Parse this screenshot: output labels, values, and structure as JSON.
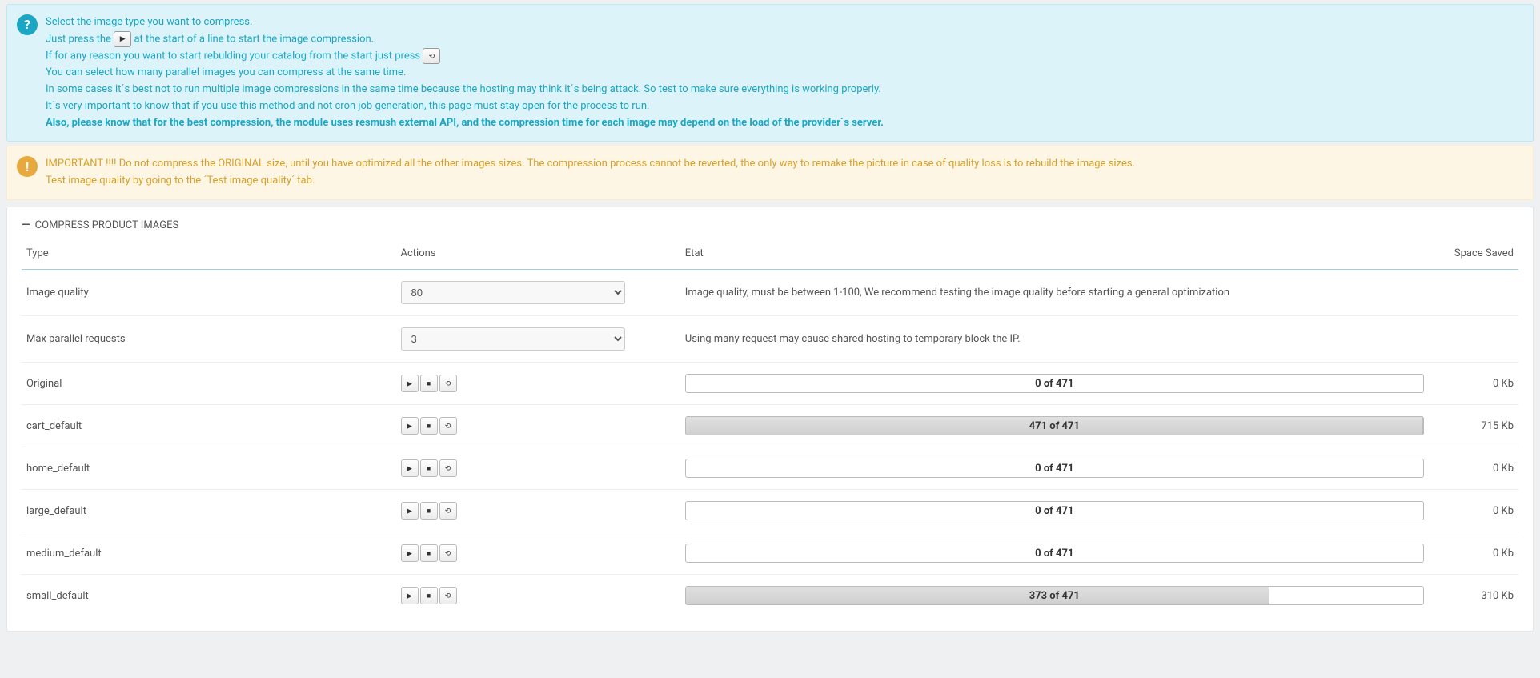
{
  "info_alert": {
    "line1": "Select the image type you want to compress.",
    "line2_a": "Just press the",
    "line2_b": "at the start of a line to start the image compression.",
    "line3_a": "If for any reason you want to start rebulding your catalog from the start just press",
    "line4": "You can select how many parallel images you can compress at the same time.",
    "line5": "In some cases it´s best not to run multiple image compressions in the same time because the hosting may think it´s being attack. So test to make sure everything is working properly.",
    "line6": "It´s very important to know that if you use this method and not cron job generation, this page must stay open for the process to run.",
    "line7": "Also, please know that for the best compression, the module uses resmush external API, and the compression time for each image may depend on the load of the provider´s server."
  },
  "warning_alert": {
    "l1": "IMPORTANT !!!! Do not compress the ORIGINAL size, until you have optimized all the other images sizes. The compression process cannot be reverted, the only way to remake the picture in case of quality loss is to rebuild the image sizes.",
    "l2": "Test image quality by going to the ´Test image quality´ tab."
  },
  "panel": {
    "title": "COMPRESS PRODUCT IMAGES"
  },
  "table": {
    "headers": {
      "type": "Type",
      "actions": "Actions",
      "etat": "Etat",
      "saved": "Space Saved"
    }
  },
  "settings": {
    "image_quality": {
      "label": "Image quality",
      "value": "80",
      "hint": "Image quality, must be between 1-100, We recommend testing the image quality before starting a general optimization"
    },
    "max_parallel": {
      "label": "Max parallel requests",
      "value": "3",
      "hint": "Using many request may cause shared hosting to temporary block the IP."
    }
  },
  "rows": [
    {
      "type": "Original",
      "done": 0,
      "total": 471,
      "saved": "0 Kb"
    },
    {
      "type": "cart_default",
      "done": 471,
      "total": 471,
      "saved": "715 Kb"
    },
    {
      "type": "home_default",
      "done": 0,
      "total": 471,
      "saved": "0 Kb"
    },
    {
      "type": "large_default",
      "done": 0,
      "total": 471,
      "saved": "0 Kb"
    },
    {
      "type": "medium_default",
      "done": 0,
      "total": 471,
      "saved": "0 Kb"
    },
    {
      "type": "small_default",
      "done": 373,
      "total": 471,
      "saved": "310 Kb"
    }
  ]
}
